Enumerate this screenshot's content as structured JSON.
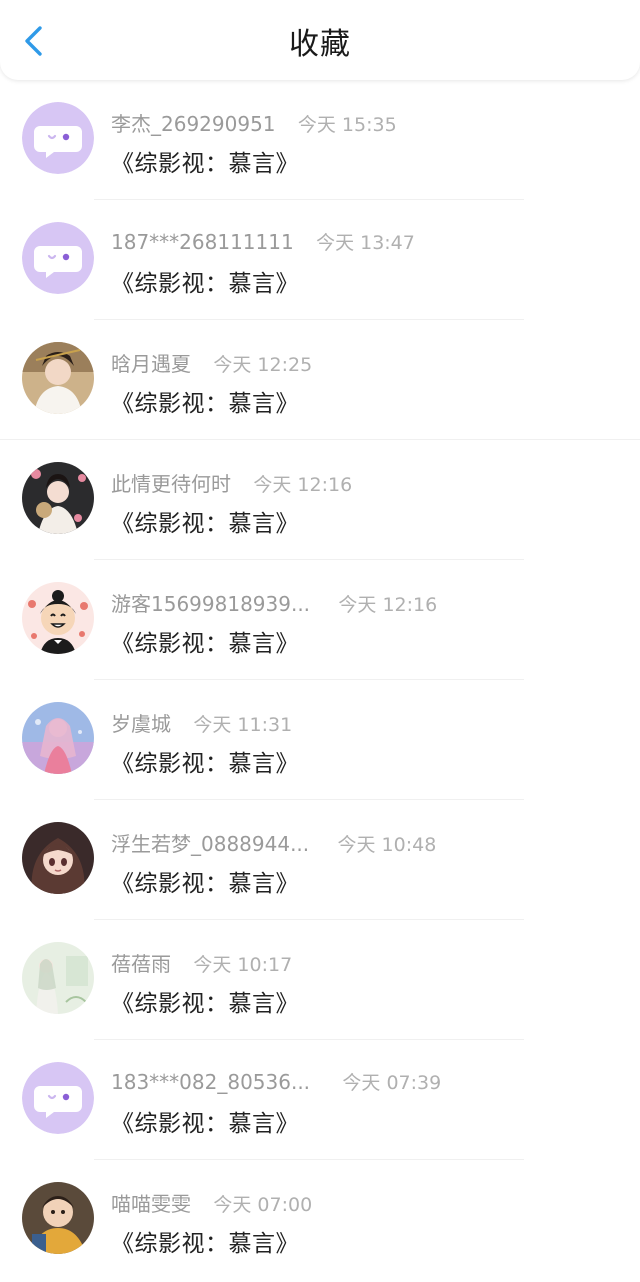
{
  "header": {
    "title": "收藏"
  },
  "colors": {
    "accent": "#2f9ae8",
    "default_avatar_bg": "#d7c6f4",
    "default_avatar_bubble": "#ffffff"
  },
  "entries": [
    {
      "user": "李杰_269290951",
      "time": "今天 15:35",
      "title": "《综影视：慕言》",
      "avatar": "default-avatar-icon"
    },
    {
      "user": "187***268111111",
      "time": "今天 13:47",
      "title": "《综影视：慕言》",
      "avatar": "default-avatar-icon"
    },
    {
      "user": "晗月遇夏",
      "time": "今天 12:25",
      "title": "《综影视：慕言》",
      "avatar": "photo-avatar"
    },
    {
      "user": "此情更待何时",
      "time": "今天 12:16",
      "title": "《综影视：慕言》",
      "avatar": "photo-avatar"
    },
    {
      "user": "游客15699818939...",
      "time": "今天 12:16",
      "title": "《综影视：慕言》",
      "avatar": "cartoon-avatar"
    },
    {
      "user": "岁虞城",
      "time": "今天 11:31",
      "title": "《综影视：慕言》",
      "avatar": "illustration-avatar"
    },
    {
      "user": "浮生若梦_0888944...",
      "time": "今天 10:48",
      "title": "《综影视：慕言》",
      "avatar": "anime-avatar"
    },
    {
      "user": "蓓蓓雨",
      "time": "今天 10:17",
      "title": "《综影视：慕言》",
      "avatar": "illustration-avatar"
    },
    {
      "user": "183***082_80536...",
      "time": "今天 07:39",
      "title": "《综影视：慕言》",
      "avatar": "default-avatar-icon"
    },
    {
      "user": "喵喵雯雯",
      "time": "今天 07:00",
      "title": "《综影视：慕言》",
      "avatar": "photo-avatar"
    }
  ]
}
